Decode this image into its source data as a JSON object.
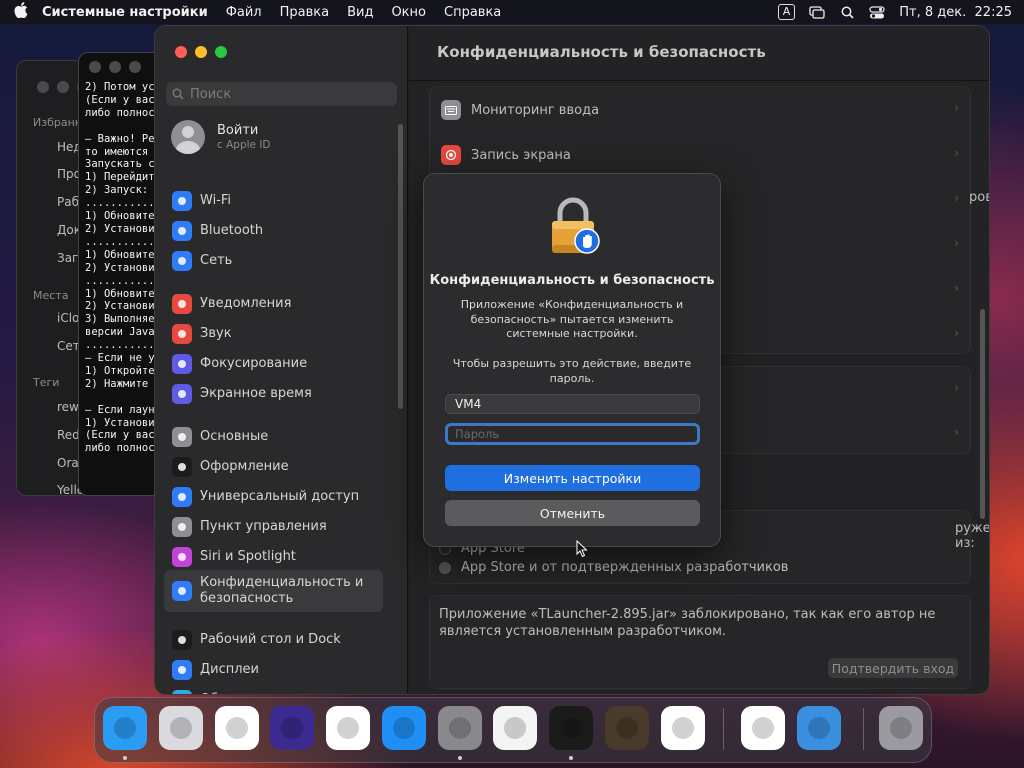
{
  "menubar": {
    "app_name": "Системные настройки",
    "menus": [
      "Файл",
      "Правка",
      "Вид",
      "Окно",
      "Справка"
    ],
    "input_badge": "A",
    "datetime": "Пт, 8 дек.  22:25"
  },
  "finder": {
    "sections": [
      "Избранное",
      "Места",
      "Теги"
    ],
    "favorites": [
      "Недавние",
      "Программы",
      "Рабочий стол",
      "Документы",
      "Загрузки"
    ],
    "places": [
      "iCloud",
      "Сеть"
    ],
    "tags": [
      "rew",
      "Red",
      "Orange",
      "Yellow"
    ]
  },
  "terminal": {
    "lines": [
      "2) Потом ус",
      "(Если у вас",
      "либо полнос",
      "",
      "– Важно! Ре",
      "то имеются ",
      "Запускать с",
      "1) Перейдит",
      "2) Запуск: ",
      "...........",
      "1) Обновите",
      "2) Установи",
      "...........",
      "1) Обновите",
      "2) Установи",
      "...........",
      "1) Обновите",
      "2) Установи",
      "3) Выполняе",
      "версии Java",
      "...........",
      "– Если не у",
      "1) Откройте",
      "2) Нажмите ",
      "",
      "– Если лаун",
      "1) Установи",
      "(Если у вас",
      "либо полнос"
    ]
  },
  "sidebar": {
    "search_placeholder": "Поиск",
    "login_title": "Войти",
    "login_subtitle": "с Apple ID",
    "items": [
      {
        "label": "Wi-Fi",
        "icon": "wifi-icon",
        "color": "#2f7cf6"
      },
      {
        "label": "Bluetooth",
        "icon": "bluetooth-icon",
        "color": "#2f7cf6"
      },
      {
        "label": "Сеть",
        "icon": "globe-icon",
        "color": "#2f7cf6"
      },
      {
        "label": "Уведомления",
        "icon": "bell-icon",
        "color": "#e5493f"
      },
      {
        "label": "Звук",
        "icon": "speaker-icon",
        "color": "#e5493f"
      },
      {
        "label": "Фокусирование",
        "icon": "moon-icon",
        "color": "#5e5ce6"
      },
      {
        "label": "Экранное время",
        "icon": "hourglass-icon",
        "color": "#5e5ce6"
      },
      {
        "label": "Основные",
        "icon": "gear-icon",
        "color": "#8e8e93"
      },
      {
        "label": "Оформление",
        "icon": "appearance-icon",
        "color": "#1c1c1e"
      },
      {
        "label": "Универсальный доступ",
        "icon": "accessibility-icon",
        "color": "#2f7cf6"
      },
      {
        "label": "Пункт управления",
        "icon": "control-center-icon",
        "color": "#8e8e93"
      },
      {
        "label": "Siri и Spotlight",
        "icon": "siri-icon",
        "color": "#c144d6"
      },
      {
        "label": "Конфиденциальность и безопасность",
        "icon": "privacy-hand-icon",
        "color": "#2f7cf6"
      },
      {
        "label": "Рабочий стол и Dock",
        "icon": "dock-icon",
        "color": "#1c1c1e"
      },
      {
        "label": "Дисплеи",
        "icon": "display-icon",
        "color": "#2f7cf6"
      },
      {
        "label": "Обои",
        "icon": "wallpaper-icon",
        "color": "#36a7e0"
      }
    ]
  },
  "content": {
    "title": "Конфиденциальность и безопасность",
    "rows": [
      {
        "label": "Мониторинг ввода",
        "icon": "keyboard-icon",
        "color": "#8e8e93"
      },
      {
        "label": "Запись экрана",
        "icon": "screen-record-icon",
        "color": "#e5493f"
      }
    ],
    "partial_row_suffix": "ров",
    "allow_from_fragment": "ружены из:",
    "radio_options": [
      "App Store",
      "App Store и от подтвержденных разработчиков"
    ],
    "blocked_message": "Приложение «TLauncher-2.895.jar» заблокировано, так как его автор не является установленным разработчиком.",
    "confirm_button": "Подтвердить вход"
  },
  "dialog": {
    "title": "Конфиденциальность и безопасность",
    "message": "Приложение «Конфиденциальность и безопасность» пытается изменить системные настройки.",
    "prompt": "Чтобы разрешить это действие, введите пароль.",
    "username": "VM4",
    "password_placeholder": "Пароль",
    "primary_button": "Изменить настройки",
    "cancel_button": "Отменить"
  },
  "dock": {
    "apps": [
      {
        "name": "finder-icon",
        "color": "#2a9cf4",
        "running": true
      },
      {
        "name": "launchpad-icon",
        "color": "#d9d9de",
        "running": false
      },
      {
        "name": "safari-icon",
        "color": "#ffffff",
        "running": false
      },
      {
        "name": "firefox-icon",
        "color": "#3b2a8f",
        "running": false
      },
      {
        "name": "chrome-icon",
        "color": "#ffffff",
        "running": false
      },
      {
        "name": "app-store-icon",
        "color": "#1f8ff5",
        "running": false
      },
      {
        "name": "system-settings-icon",
        "color": "#8a8a8e",
        "running": true
      },
      {
        "name": "textedit-icon",
        "color": "#f4f4f4",
        "running": false
      },
      {
        "name": "terminal-icon",
        "color": "#1b1b1b",
        "running": true
      },
      {
        "name": "garageband-icon",
        "color": "#4a3a2a",
        "running": false
      },
      {
        "name": "vscode-icon",
        "color": "#ffffff",
        "running": false
      },
      {
        "name": "visual-studio-icon",
        "color": "#ffffff",
        "running": false
      },
      {
        "name": "weather-icon",
        "color": "#3a8fe0",
        "running": false
      },
      {
        "name": "trash-icon",
        "color": "#9a9aa0",
        "running": false
      }
    ]
  }
}
